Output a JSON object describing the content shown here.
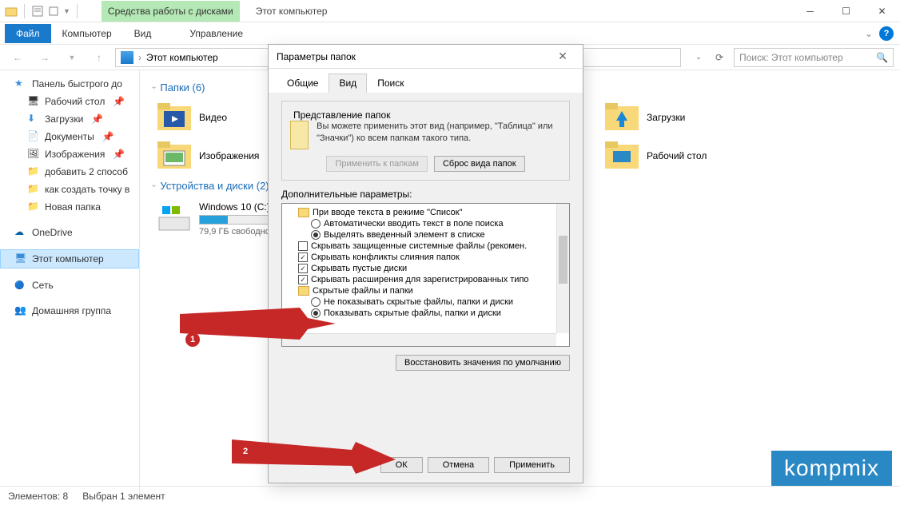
{
  "window": {
    "context_tab": "Средства работы с дисками",
    "title": "Этот компьютер"
  },
  "ribbon": {
    "file": "Файл",
    "computer": "Компьютер",
    "view": "Вид",
    "manage": "Управление"
  },
  "address": {
    "path": "Этот компьютер",
    "search_placeholder": "Поиск: Этот компьютер"
  },
  "sidebar": {
    "quick": "Панель быстрого до",
    "desktop": "Рабочий стол",
    "downloads": "Загрузки",
    "documents": "Документы",
    "pictures": "Изображения",
    "add2": "добавить 2 способ",
    "create_point": "как создать точку в",
    "new_folder": "Новая папка",
    "onedrive": "OneDrive",
    "thispc": "Этот компьютер",
    "network": "Сеть",
    "homegroup": "Домашняя группа"
  },
  "content": {
    "folders_header": "Папки (6)",
    "videos": "Видео",
    "downloads": "Загрузки",
    "pictures": "Изображения",
    "desktop": "Рабочий стол",
    "drives_header": "Устройства и диски (2)",
    "drive_c_label": "Windows 10 (C:)",
    "drive_c_sub": "79,9 ГБ свободно"
  },
  "dialog": {
    "title": "Параметры папок",
    "tab_general": "Общие",
    "tab_view": "Вид",
    "tab_search": "Поиск",
    "fieldset_title": "Представление папок",
    "fv_text": "Вы можете применить этот вид (например, \"Таблица\" или \"Значки\") ко всем папкам такого типа.",
    "btn_apply_folders": "Применить к папкам",
    "btn_reset_folders": "Сброс вида папок",
    "adv_label": "Дополнительные параметры:",
    "tree": {
      "t1": "При вводе текста в режиме \"Список\"",
      "t1a": "Автоматически вводить текст в поле поиска",
      "t1b": "Выделять введенный элемент в списке",
      "t2": "Скрывать защищенные системные файлы (рекомен.",
      "t3": "Скрывать конфликты слияния папок",
      "t4": "Скрывать пустые диски",
      "t5": "Скрывать расширения для зарегистрированных типо",
      "t6": "Скрытые файлы и папки",
      "t6a": "Не показывать скрытые файлы, папки и диски",
      "t6b": "Показывать скрытые файлы, папки и диски"
    },
    "btn_restore": "Восстановить значения по умолчанию",
    "btn_ok": "ОК",
    "btn_cancel": "Отмена",
    "btn_apply": "Применить"
  },
  "status": {
    "elements": "Элементов: 8",
    "selected": "Выбран 1 элемент"
  },
  "anno": {
    "a1": "1",
    "a2": "2"
  },
  "watermark": "kompmix"
}
